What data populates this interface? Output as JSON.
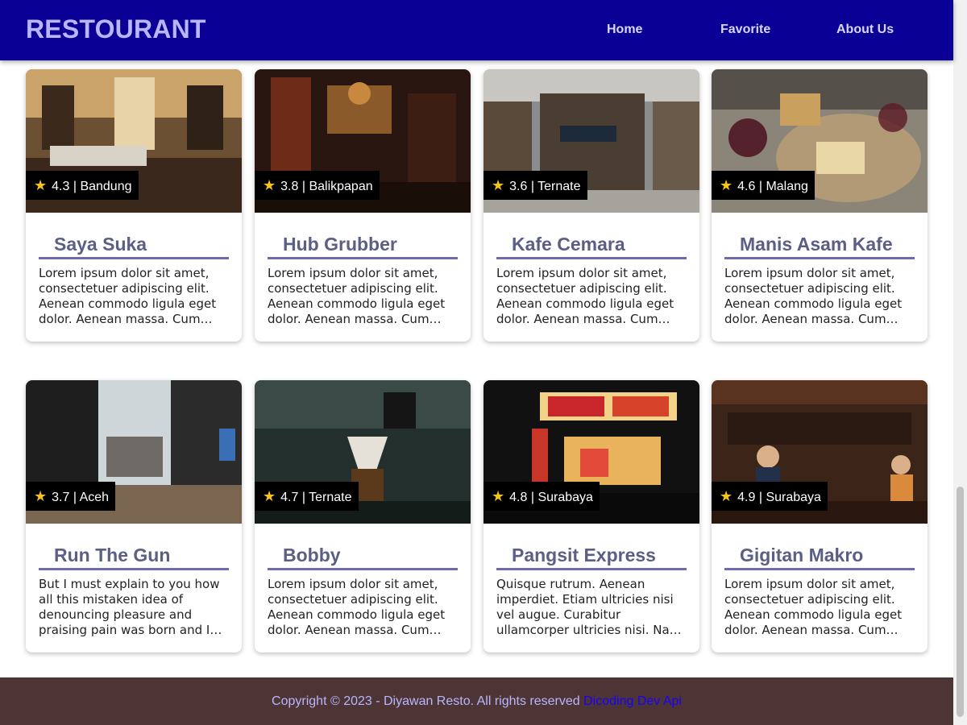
{
  "header": {
    "brand": "RESTOURANT",
    "nav": [
      "Home",
      "Favorite",
      "About Us"
    ],
    "background": "#0a0096"
  },
  "restaurants": [
    {
      "name": "Saya Suka",
      "rating": "4.3",
      "city": "Bandung",
      "description": "Lorem ipsum dolor sit amet, consectetuer adipiscing elit. Aenean commodo ligula eget dolor. Aenean massa. Cum…"
    },
    {
      "name": "Hub Grubber",
      "rating": "3.8",
      "city": "Balikpapan",
      "description": "Lorem ipsum dolor sit amet, consectetuer adipiscing elit. Aenean commodo ligula eget dolor. Aenean massa. Cum…"
    },
    {
      "name": "Kafe Cemara",
      "rating": "3.6",
      "city": "Ternate",
      "description": "Lorem ipsum dolor sit amet, consectetuer adipiscing elit. Aenean commodo ligula eget dolor. Aenean massa. Cum…"
    },
    {
      "name": "Manis Asam Kafe",
      "rating": "4.6",
      "city": "Malang",
      "description": "Lorem ipsum dolor sit amet, consectetuer adipiscing elit. Aenean commodo ligula eget dolor. Aenean massa. Cum…"
    },
    {
      "name": "Run The Gun",
      "rating": "3.7",
      "city": "Aceh",
      "description": "But I must explain to you how all this mistaken idea of denouncing pleasure and praising pain was born and I will give you a…"
    },
    {
      "name": "Bobby",
      "rating": "4.7",
      "city": "Ternate",
      "description": "Lorem ipsum dolor sit amet, consectetuer adipiscing elit. Aenean commodo ligula eget dolor. Aenean massa. Cum…"
    },
    {
      "name": "Pangsit Express",
      "rating": "4.8",
      "city": "Surabaya",
      "description": "Quisque rutrum. Aenean imperdiet. Etiam ultricies nisi vel augue. Curabitur ullamcorper ultricies nisi. Nam eget dui.…"
    },
    {
      "name": "Gigitan Makro",
      "rating": "4.9",
      "city": "Surabaya",
      "description": "Lorem ipsum dolor sit amet, consectetuer adipiscing elit. Aenean commodo ligula eget dolor. Aenean massa. Cum…"
    }
  ],
  "footer": {
    "text": "Copyright © 2023 - Diyawan Resto. All rights reserved",
    "link": "Dicoding Dev Api"
  },
  "colors": {
    "accent": "#6e6ab0",
    "star": "#f5c518",
    "footer_bg": "#4e3535"
  }
}
